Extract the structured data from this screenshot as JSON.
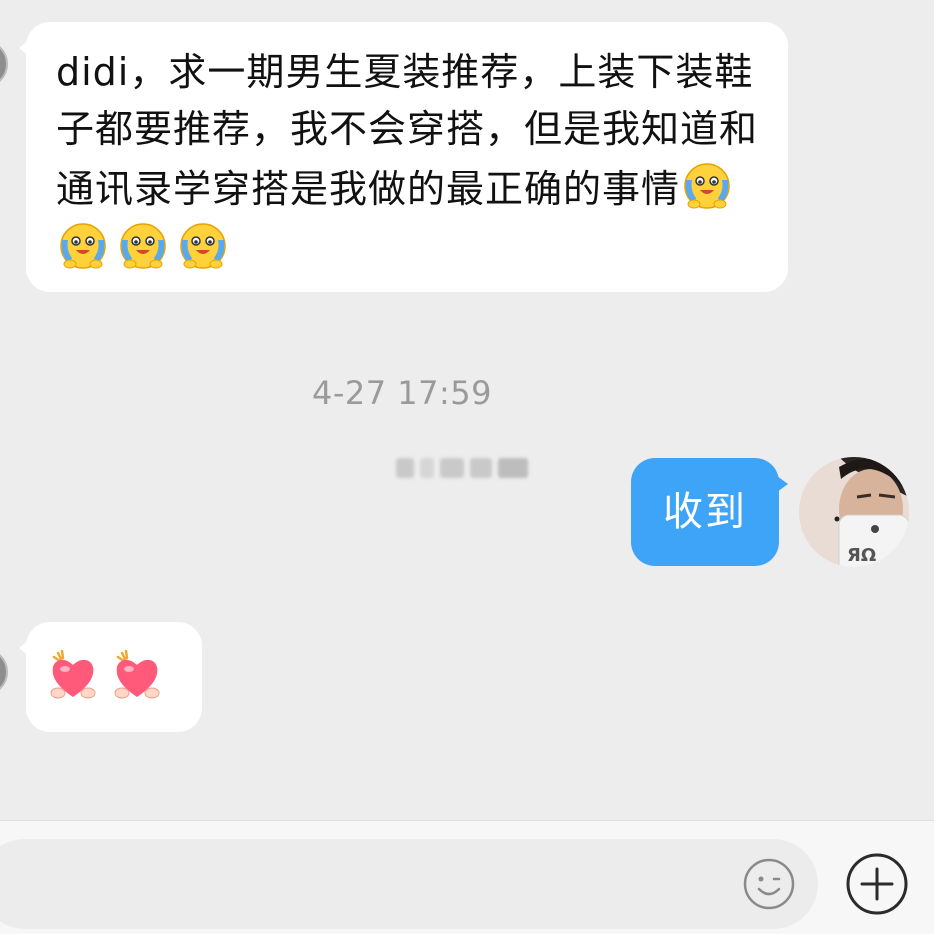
{
  "messages": {
    "incoming_1": {
      "text": "didi，求一期男生夏装推荐，上装下装鞋子都要推荐，我不会穿搭，但是我知道和通讯录学穿搭是我做的最正确的事情",
      "emojis": [
        "crying-laughing-face-icon",
        "crying-laughing-face-icon",
        "crying-laughing-face-icon",
        "crying-laughing-face-icon"
      ]
    },
    "timestamp": "4-27 17:59",
    "outgoing_1": {
      "text": "收到"
    },
    "incoming_2": {
      "emojis": [
        "heart-hug-icon",
        "heart-hug-icon"
      ]
    }
  },
  "input_bar": {
    "emoji_icon": "smiley-icon",
    "plus_icon": "plus-circle-icon"
  },
  "colors": {
    "background": "#ededed",
    "incoming_bubble": "#ffffff",
    "outgoing_bubble": "#3ea4f8",
    "timestamp": "#9a9a9a"
  }
}
